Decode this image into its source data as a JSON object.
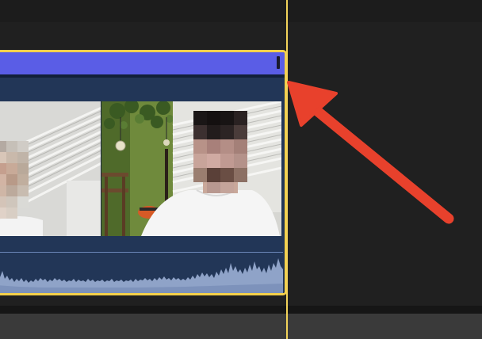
{
  "timeline": {
    "playhead_color": "#f2d35a",
    "selection_border_color": "#f5d04a"
  },
  "clip": {
    "title_bar_color": "#5a5de6",
    "body_color": "#213455",
    "faces_blurred": true
  },
  "annotation": {
    "arrow_color": "#e8412c",
    "arrow_points_to": "end-of-clip"
  }
}
